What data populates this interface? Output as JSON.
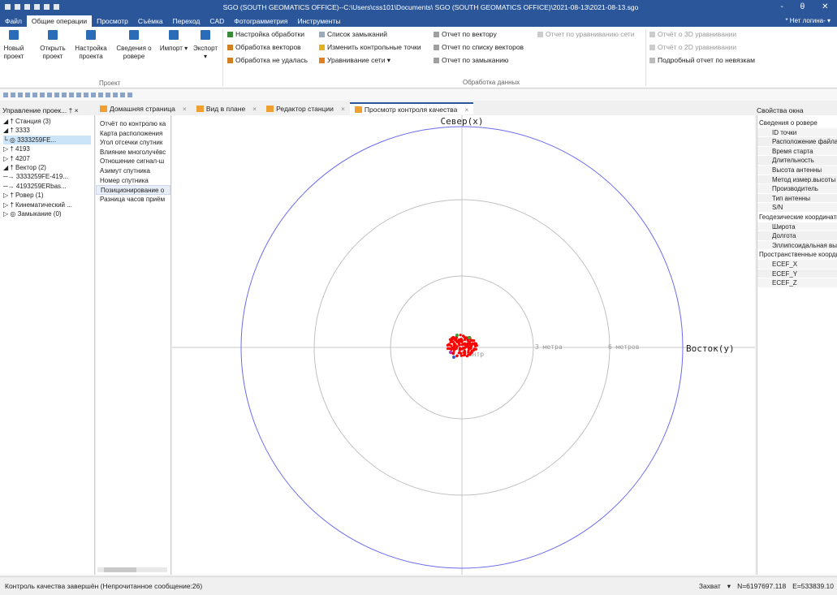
{
  "window": {
    "title": "SGO (SOUTH GEOMATICS OFFICE)--C:\\Users\\css101\\Documents\\ SGO (SOUTH GEOMATICS OFFICE)\\2021-08-13\\2021-08-13.sgo",
    "minimize": "-",
    "maximize": "θ",
    "close": "✕"
  },
  "menu": {
    "items": [
      "Файл",
      "Общие операции",
      "Просмотр",
      "Съёмка",
      "Переход",
      "CAD",
      "Фотограмметрия",
      "Инструменты"
    ],
    "login": "* Нет логина- ▾"
  },
  "ribbon": {
    "project_buttons": [
      {
        "label": "Новый проект"
      },
      {
        "label": "Открыть проект"
      },
      {
        "label": "Настройка проекта"
      },
      {
        "label": "Сведения о ровере"
      },
      {
        "label": "Импорт ▾"
      },
      {
        "label": "Экспорт ▾"
      }
    ],
    "project_group": "Проект",
    "processing": {
      "col1": [
        "Настройка обработки",
        "Обработка векторов",
        "Обработка не удалась"
      ],
      "col2": [
        "Список замыканий",
        "Изменить контрольные точки",
        "Уравнивание сети ▾"
      ],
      "col3": [
        "Отчет по вектору",
        "Отчет по списку векторов",
        "Отчет по замыканию"
      ],
      "col4": [
        "Отчет по уравниванию сети"
      ],
      "col5": [
        "Отчёт о 3D уравнивании",
        "Отчёт о 2D уравнивании",
        "Подробный отчет по невязкам"
      ],
      "group": "Обработка данных"
    }
  },
  "tabs": {
    "panel_title": "Управление проек... † ×",
    "items": [
      {
        "label": "Домашняя страница",
        "active": false
      },
      {
        "label": "Вид в плане",
        "active": false
      },
      {
        "label": "Редактор станции",
        "active": false
      },
      {
        "label": "Просмотр контроля качества",
        "active": true
      }
    ],
    "close": "×",
    "props_title": "Свойства окна"
  },
  "tree": [
    "◢ † Станция (3)",
    "    ◢ † 3333",
    "         └ ◎ 3333259FE...",
    "    ▷ † 4193",
    "    ▷ † 4207",
    "◢ † Вектор (2)",
    "    ─→ 3333259FE-419...",
    "    ─→ 4193259ERbas...",
    "▷ † Ровер (1)",
    "▷ † Кинематический ...",
    "▷ ◎ Замыкание (0)"
  ],
  "qc_list": [
    "Отчёт по контролю ка",
    "Карта расположения",
    "Угол отсечки спутник",
    "Влияние многолучёвс",
    "Отношение сигнал-ш",
    "Азимут спутника",
    "Номер спутника",
    "Позиционирование о",
    "Разница часов приём"
  ],
  "plot": {
    "north_label": "Север(x)",
    "east_label": "Восток(y)",
    "ring_labels": [
      "3 метра",
      "6 метров"
    ],
    "center_label": "Центр",
    "scatter_color": "#ff0000"
  },
  "properties": {
    "groups": [
      {
        "title": "Сведения о ровере",
        "rows": [
          "ID точки",
          "Расположение файла",
          "Время старта",
          "Длительность",
          "Высота антенны",
          "Метод измер.высоты",
          "Производитель",
          "Тип антенны",
          "S/N"
        ]
      },
      {
        "title": "Геодезические координаты",
        "rows": [
          "Широта",
          "Долгота",
          "Эллипсоидальная высота"
        ]
      },
      {
        "title": "Пространственные координаты",
        "rows": [
          "ECEF_X",
          "ECEF_Y",
          "ECEF_Z"
        ]
      }
    ]
  },
  "status": {
    "message": "Контроль качества завершён (Непрочитанное сообщение:26)",
    "snap": "Захват",
    "north": "N=6197697.118",
    "east": "E=533839.10"
  }
}
